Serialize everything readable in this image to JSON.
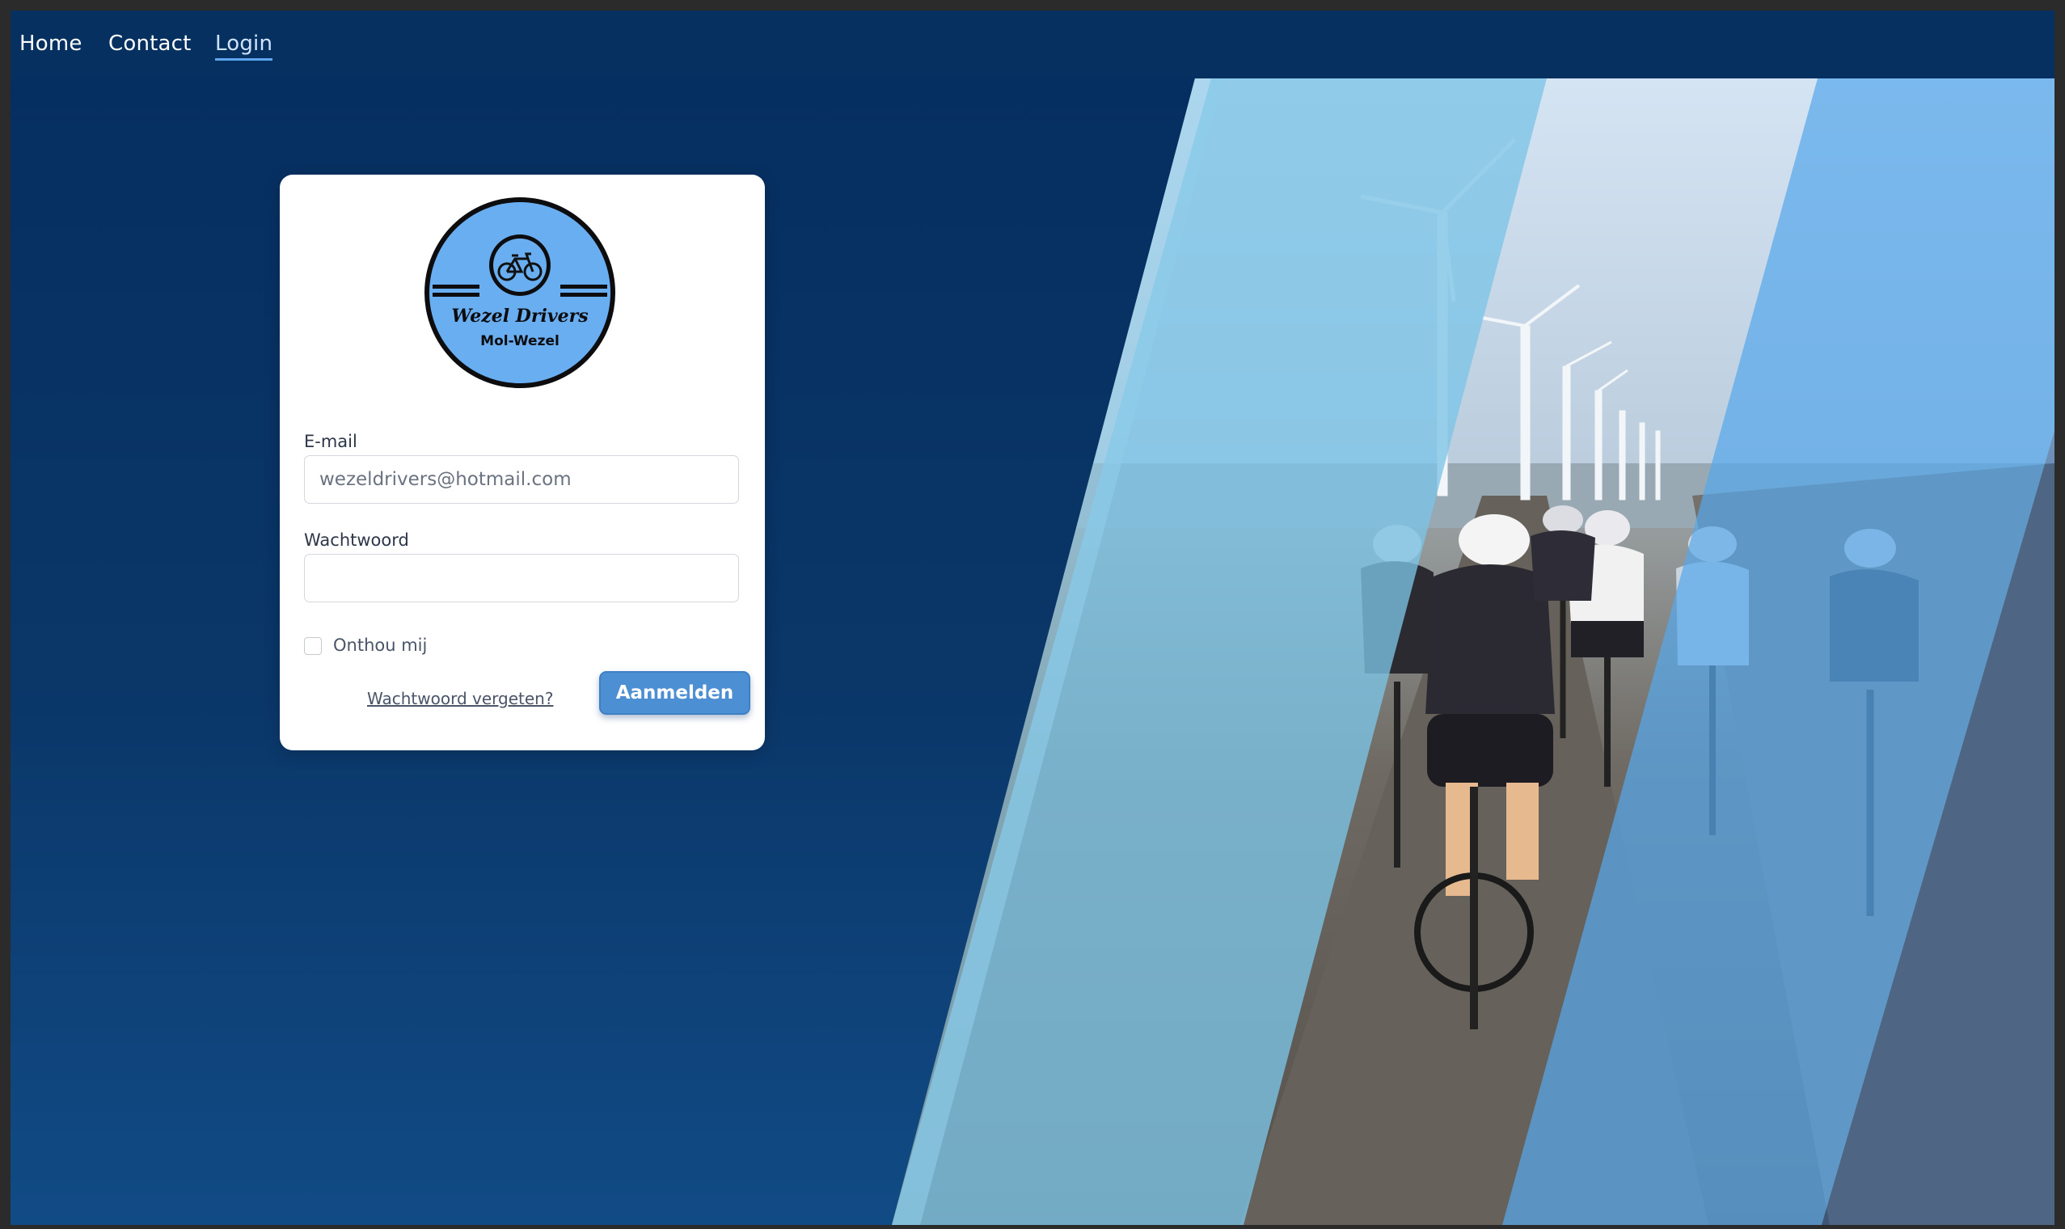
{
  "nav": {
    "items": [
      {
        "label": "Home"
      },
      {
        "label": "Contact"
      },
      {
        "label": "Login",
        "active": true
      }
    ]
  },
  "logo": {
    "line1": "Wezel Drivers",
    "line2": "Mol-Wezel",
    "icon": "bicycle-icon"
  },
  "form": {
    "email_label": "E-mail",
    "email_value": "wezeldrivers@hotmail.com",
    "password_label": "Wachtwoord",
    "password_value": "",
    "remember_label": "Onthou mij",
    "remember_checked": false,
    "forgot_label": "Wachtwoord vergeten?",
    "submit_label": "Aanmelden"
  },
  "colors": {
    "background": "#0a3361",
    "navbar": "#05305f",
    "accent": "#4d8fd3",
    "logo_fill": "#6aaef2"
  }
}
